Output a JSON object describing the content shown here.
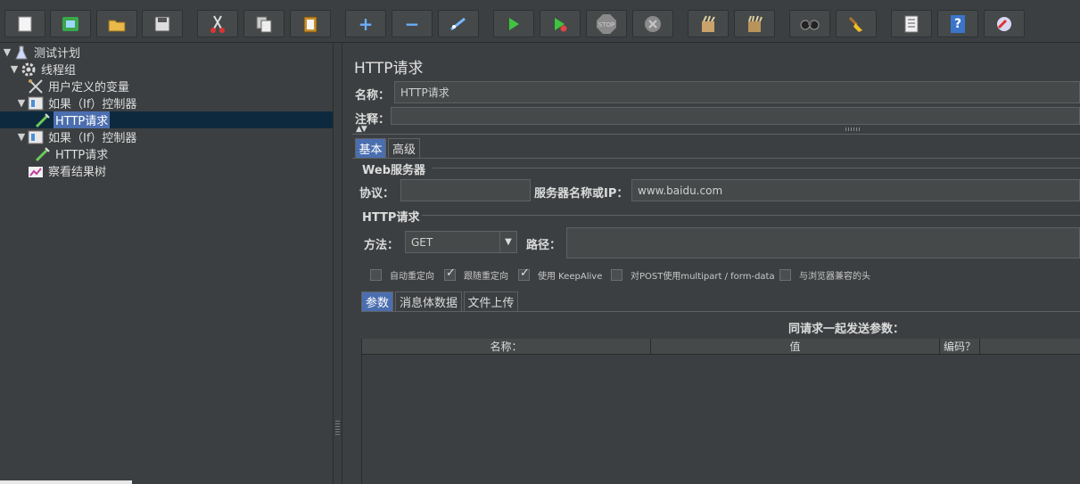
{
  "toolbar": {
    "buttons": [
      {
        "icon": "new-icon"
      },
      {
        "icon": "templates-icon"
      },
      {
        "icon": "open-icon"
      },
      {
        "icon": "save-icon"
      },
      {
        "icon": "cut-icon"
      },
      {
        "icon": "copy-icon"
      },
      {
        "icon": "paste-icon"
      },
      {
        "icon": "expand-icon",
        "glyph": "+"
      },
      {
        "icon": "collapse-icon",
        "glyph": "−"
      },
      {
        "icon": "toggle-icon"
      },
      {
        "icon": "start-icon"
      },
      {
        "icon": "start-no-pause-icon"
      },
      {
        "icon": "stop-icon",
        "glyph": "STOP"
      },
      {
        "icon": "shutdown-icon"
      },
      {
        "icon": "clear-icon"
      },
      {
        "icon": "clear-all-icon"
      },
      {
        "icon": "search-icon"
      },
      {
        "icon": "reset-search-icon"
      },
      {
        "icon": "function-helper-icon"
      },
      {
        "icon": "help-icon",
        "glyph": "?"
      },
      {
        "icon": "remote-icon"
      }
    ]
  },
  "tree": {
    "items": [
      {
        "label": "测试计划",
        "icon": "test-plan-icon",
        "expanded": true
      },
      {
        "label": "线程组",
        "icon": "thread-group-icon",
        "expanded": true
      },
      {
        "label": "用户定义的变量",
        "icon": "user-variables-icon"
      },
      {
        "label": "如果（If）控制器",
        "icon": "if-controller-icon",
        "expanded": true
      },
      {
        "label": "HTTP请求",
        "icon": "http-sampler-icon",
        "selected": true
      },
      {
        "label": "如果（If）控制器",
        "icon": "if-controller-icon",
        "expanded": true
      },
      {
        "label": "HTTP请求",
        "icon": "http-sampler-icon"
      },
      {
        "label": "察看结果树",
        "icon": "results-tree-icon"
      }
    ]
  },
  "panel": {
    "title": "HTTP请求",
    "name_label": "名称：",
    "name_value": "HTTP请求",
    "comment_label": "注释：",
    "comment_value": "",
    "tabs": [
      "基本",
      "高级"
    ],
    "web_server": {
      "legend": "Web服务器",
      "protocol_label": "协议：",
      "protocol_value": "",
      "server_label": "服务器名称或IP：",
      "server_value": "www.baidu.com"
    },
    "http_request": {
      "legend": "HTTP请求",
      "method_label": "方法：",
      "method_value": "GET",
      "path_label": "路径：",
      "path_value": "",
      "options": [
        {
          "label": "自动重定向",
          "checked": false
        },
        {
          "label": "跟随重定向",
          "checked": true
        },
        {
          "label": "使用 KeepAlive",
          "checked": true
        },
        {
          "label": "对POST使用multipart / form-data",
          "checked": false
        },
        {
          "label": "与浏览器兼容的头",
          "checked": false
        }
      ]
    },
    "sub_tabs": [
      "参数",
      "消息体数据",
      "文件上传"
    ],
    "params_caption": "同请求一起发送参数：",
    "table_headers": [
      "名称：",
      "值",
      "编码？"
    ]
  }
}
